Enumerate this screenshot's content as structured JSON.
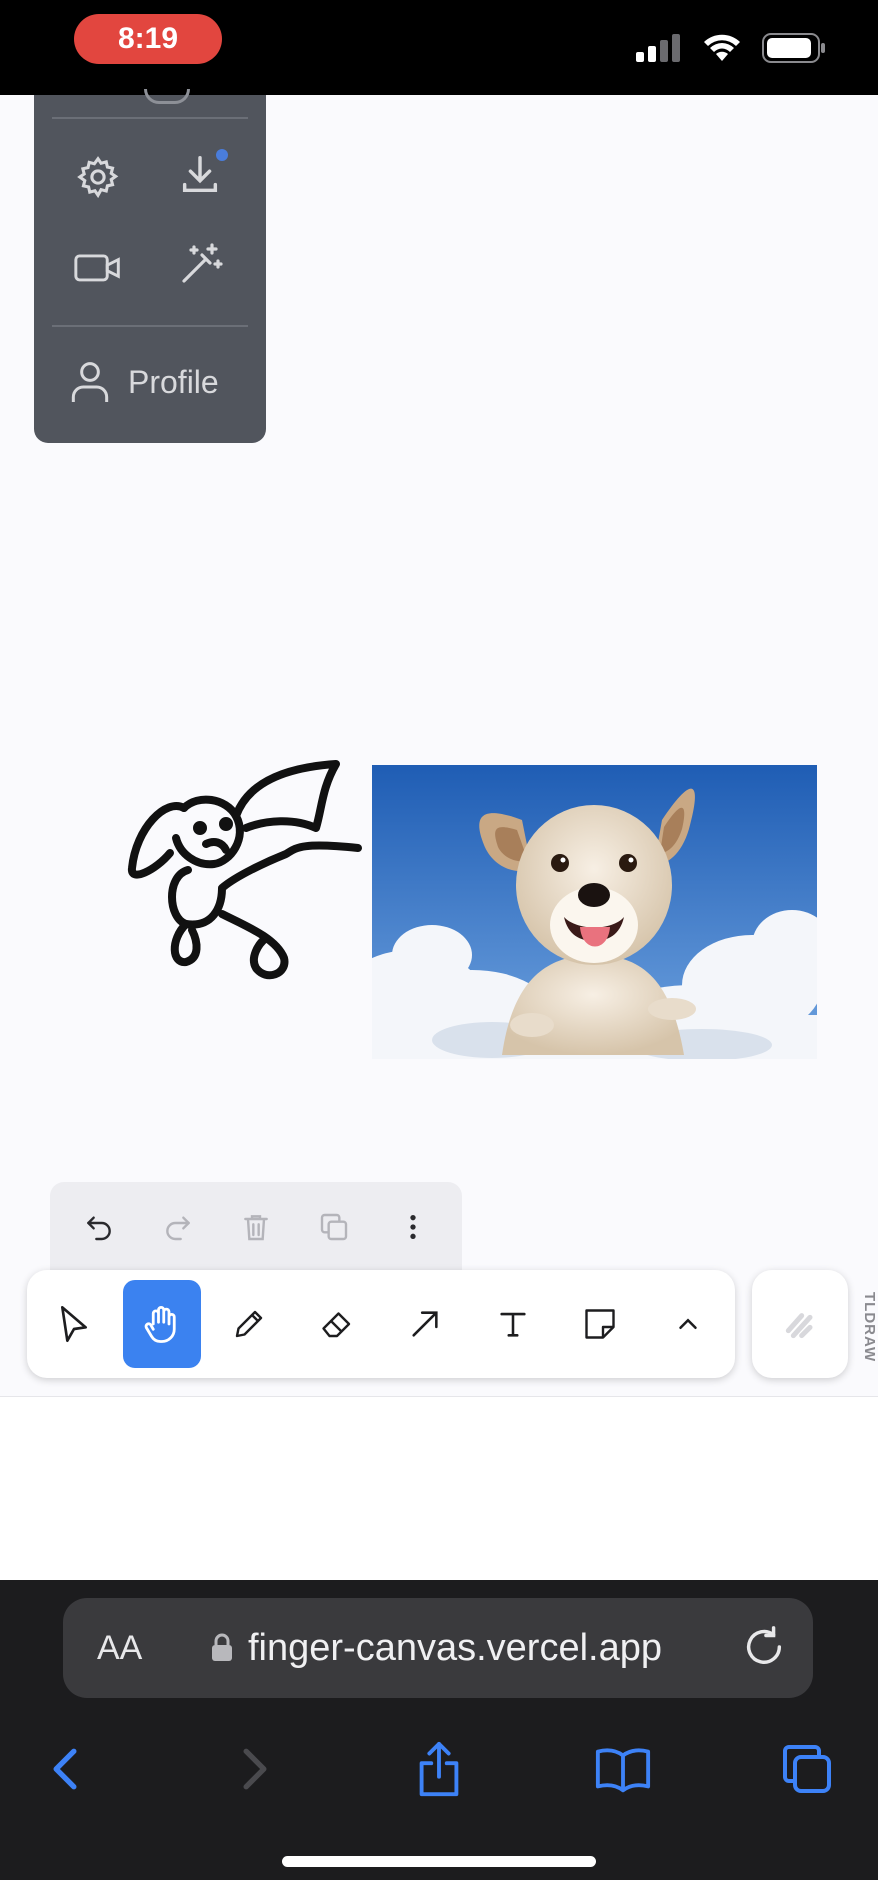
{
  "status_bar": {
    "time": "8:19"
  },
  "menu": {
    "items": [
      {
        "icon": "gear-icon"
      },
      {
        "icon": "download-icon"
      },
      {
        "icon": "video-camera-icon"
      },
      {
        "icon": "magic-wand-icon"
      }
    ],
    "profile_label": "Profile"
  },
  "canvas": {
    "shapes": [
      {
        "type": "drawing",
        "subject": "dog doodle"
      },
      {
        "type": "image",
        "subject": "dog in clouds photo"
      }
    ]
  },
  "action_bar": {
    "buttons": [
      {
        "icon": "undo-icon",
        "enabled": true
      },
      {
        "icon": "redo-icon",
        "enabled": false
      },
      {
        "icon": "trash-icon",
        "enabled": false
      },
      {
        "icon": "duplicate-icon",
        "enabled": false
      },
      {
        "icon": "more-vertical-icon",
        "enabled": true
      }
    ]
  },
  "toolbar": {
    "tools": [
      {
        "icon": "select-cursor-icon",
        "active": false
      },
      {
        "icon": "hand-icon",
        "active": true
      },
      {
        "icon": "pencil-icon",
        "active": false
      },
      {
        "icon": "eraser-icon",
        "active": false
      },
      {
        "icon": "arrow-icon",
        "active": false
      },
      {
        "icon": "text-icon",
        "active": false
      },
      {
        "icon": "note-icon",
        "active": false
      },
      {
        "icon": "chevron-up-icon",
        "active": false
      }
    ],
    "active_color": "#3b82f0"
  },
  "watermark": "TLDRAW",
  "browser": {
    "aa_label": "AA",
    "url": "finger-canvas.vercel.app"
  }
}
